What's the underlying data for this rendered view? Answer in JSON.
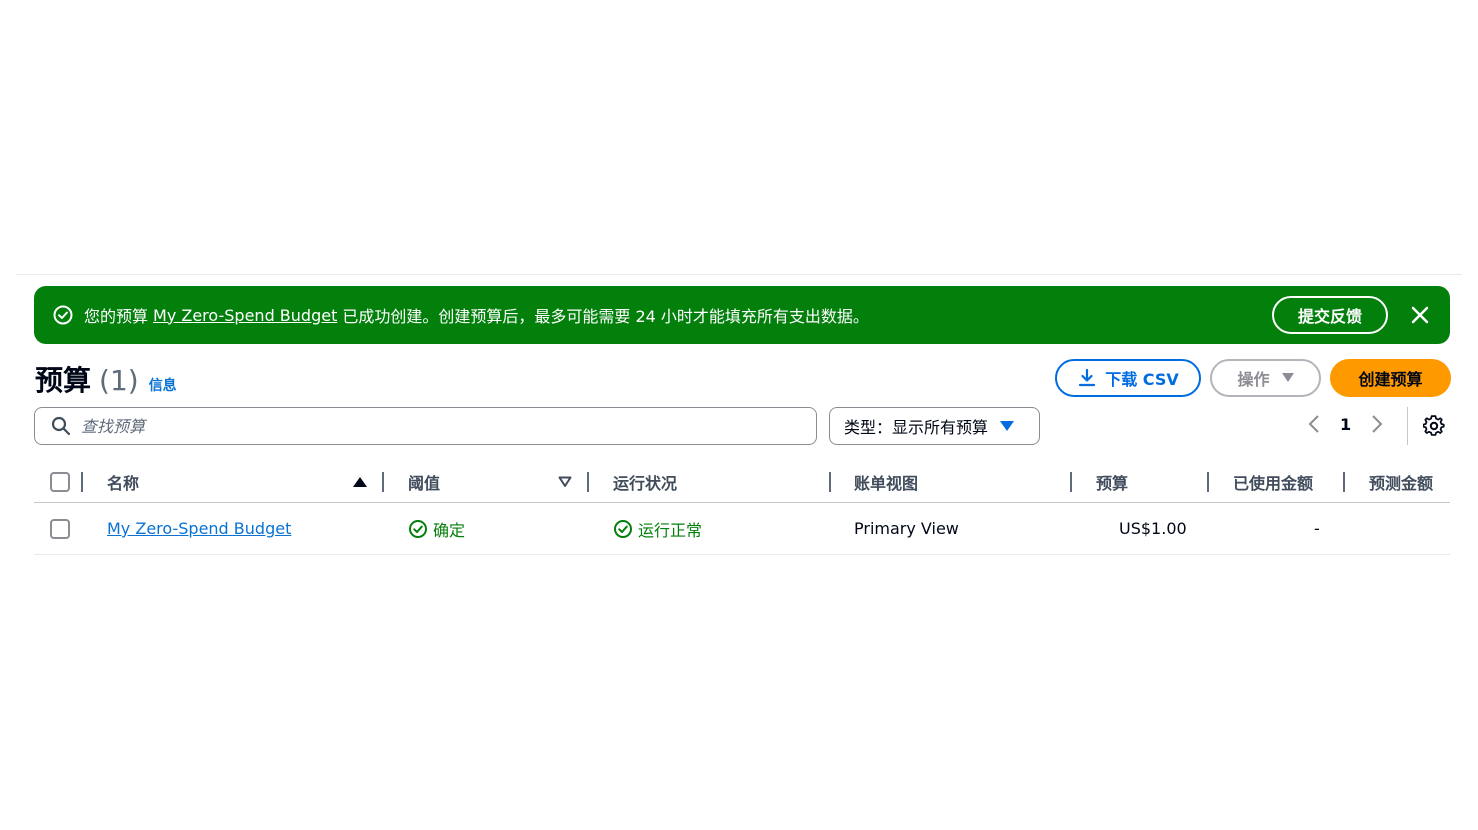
{
  "flash": {
    "message_prefix": "您的预算",
    "budget_link": "My Zero-Spend Budget",
    "message_suffix": "已成功创建。创建预算后，最多可能需要 24 小时才能填充所有支出数据。",
    "feedback_label": "提交反馈",
    "color": "#037f0c"
  },
  "header": {
    "title": "预算",
    "count": "(1)",
    "info": "信息"
  },
  "buttons": {
    "download_csv": "下载 CSV",
    "actions": "操作",
    "create": "创建预算"
  },
  "filter": {
    "search_placeholder": "查找预算",
    "type_select": "类型：显示所有预算"
  },
  "pagination": {
    "current_page": "1"
  },
  "table": {
    "columns": [
      "名称",
      "阈值",
      "运行状况",
      "账单视图",
      "预算",
      "已使用金额",
      "预测金额"
    ],
    "rows": [
      {
        "name": "My Zero-Spend Budget",
        "threshold": "确定",
        "health": "运行正常",
        "billing_view": "Primary View",
        "budget": "US$1.00",
        "used": "-",
        "forecast": ""
      }
    ]
  },
  "colors": {
    "link": "#0972d3",
    "success": "#037f0c",
    "primary_button": "#ff9900"
  }
}
